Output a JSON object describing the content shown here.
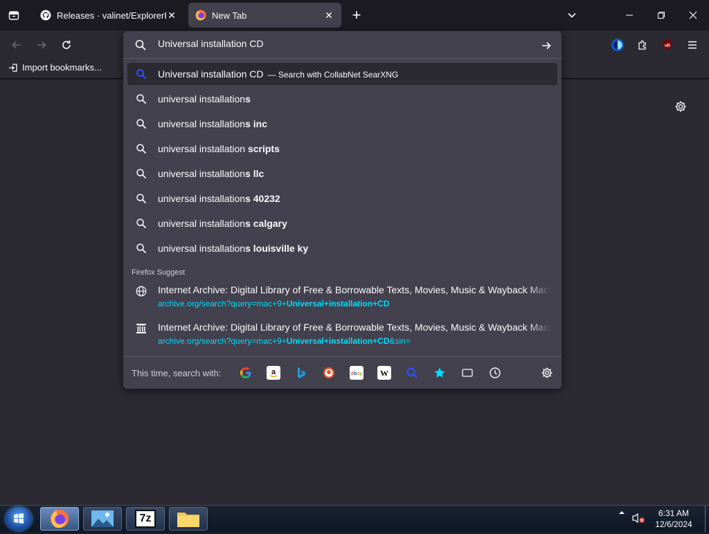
{
  "tabs": [
    {
      "title": "Releases · valinet/ExplorerPatch",
      "close": "✕"
    },
    {
      "title": "New Tab",
      "close": "✕"
    }
  ],
  "newtab": "+",
  "bookmarks": {
    "import": "Import bookmarks..."
  },
  "urlbar": {
    "value": "Universal installation CD",
    "first_result": {
      "text": "Universal installation CD",
      "action": "— Search with CollabNet SearXNG"
    },
    "suggestions": [
      {
        "prefix": "universal installation",
        "suffix": "s"
      },
      {
        "prefix": "universal installation",
        "suffix": "s inc"
      },
      {
        "prefix": "universal installation ",
        "suffix": "scripts"
      },
      {
        "prefix": "universal installation",
        "suffix": "s llc"
      },
      {
        "prefix": "universal installation",
        "suffix": "s 40232"
      },
      {
        "prefix": "universal installation",
        "suffix": "s calgary"
      },
      {
        "prefix": "universal installation",
        "suffix": "s louisville ky"
      }
    ],
    "section_label": "Firefox Suggest",
    "rich_results": [
      {
        "title": "Internet Archive: Digital Library of Free & Borrowable Texts, Movies, Music & Wayback Machine",
        "url_prefix": "archive.org/search?query=mac+9+",
        "url_bold": "Universal+installation+CD",
        "url_suffix": ""
      },
      {
        "title": "Internet Archive: Digital Library of Free & Borrowable Texts, Movies, Music & Wayback Machine",
        "url_prefix": "archive.org/search?query=mac+9+",
        "url_bold": "Universal+installation+CD",
        "url_suffix": "&sin="
      }
    ],
    "oneoff_label": "This time, search with:"
  },
  "taskbar": {
    "clock_time": "6:31 AM",
    "clock_date": "12/6/2024",
    "app_7z": "7z"
  }
}
